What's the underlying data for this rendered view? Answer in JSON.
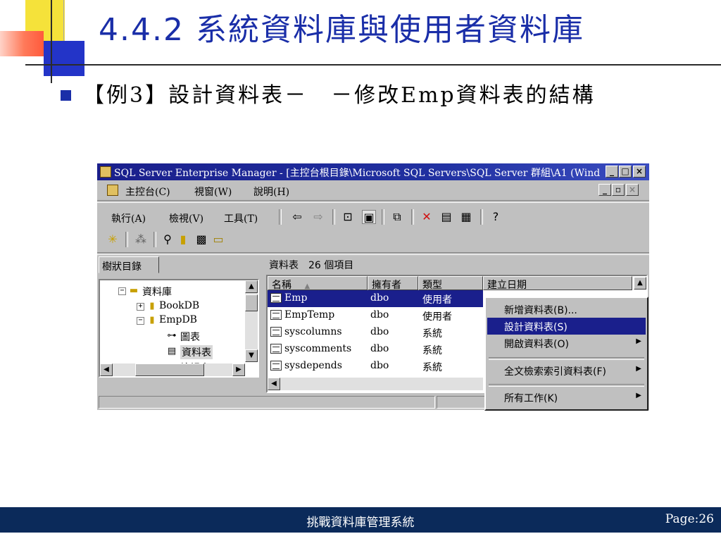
{
  "slide": {
    "title": "4.4.2 系統資料庫與使用者資料庫",
    "bullet_text": "【例3】設計資料表－　－修改Emp資料表的結構"
  },
  "window": {
    "title": "SQL Server Enterprise Manager - [主控台根目錄\\Microsoft SQL Servers\\SQL Server 群組\\A1 (Wind...",
    "title_buttons": [
      "_",
      "□",
      "×"
    ],
    "menu": [
      "主控台(C)",
      "視窗(W)",
      "說明(H)"
    ],
    "menu_right_buttons": [
      "_",
      "▫",
      "×"
    ],
    "toolbar1_menus": [
      "執行(A)",
      "檢視(V)",
      "工具(T)"
    ],
    "tree_tab": "樹狀目錄",
    "tree": [
      {
        "label": "資料庫",
        "icon": "folder-icon",
        "expander": "−"
      },
      {
        "label": "BookDB",
        "icon": "database-icon",
        "expander": "+"
      },
      {
        "label": "EmpDB",
        "icon": "database-icon",
        "expander": "−"
      },
      {
        "label": "圖表",
        "icon": "diagram-icon",
        "expander": ""
      },
      {
        "label": "資料表",
        "icon": "table-icon",
        "expander": ""
      },
      {
        "label": "檢視表",
        "icon": "view-icon",
        "expander": ""
      }
    ],
    "list_caption": "資料表　26 個項目",
    "columns": [
      "名稱",
      "擁有者",
      "類型",
      "建立日期"
    ],
    "rows": [
      {
        "name": "Emp",
        "owner": "dbo",
        "type": "使用者",
        "selected": true
      },
      {
        "name": "EmpTemp",
        "owner": "dbo",
        "type": "使用者",
        "selected": false
      },
      {
        "name": "syscolumns",
        "owner": "dbo",
        "type": "系統",
        "selected": false
      },
      {
        "name": "syscomments",
        "owner": "dbo",
        "type": "系統",
        "selected": false
      },
      {
        "name": "sysdepends",
        "owner": "dbo",
        "type": "系統",
        "selected": false
      }
    ]
  },
  "context_menu": {
    "items": [
      {
        "label": "新增資料表(B)...",
        "selected": false,
        "submenu": false
      },
      {
        "label": "設計資料表(S)",
        "selected": true,
        "submenu": false
      },
      {
        "label": "開啟資料表(O)",
        "selected": false,
        "submenu": true
      },
      {
        "label": "全文檢索索引資料表(F)",
        "selected": false,
        "submenu": true
      },
      {
        "label": "所有工作(K)",
        "selected": false,
        "submenu": true
      }
    ]
  },
  "footer": {
    "center": "挑戰資料庫管理系統",
    "page": "Page:26"
  },
  "colors": {
    "title_blue": "#1a2ea8",
    "selection_navy": "#1a1f8c",
    "footer_navy": "#0b2a5a"
  }
}
